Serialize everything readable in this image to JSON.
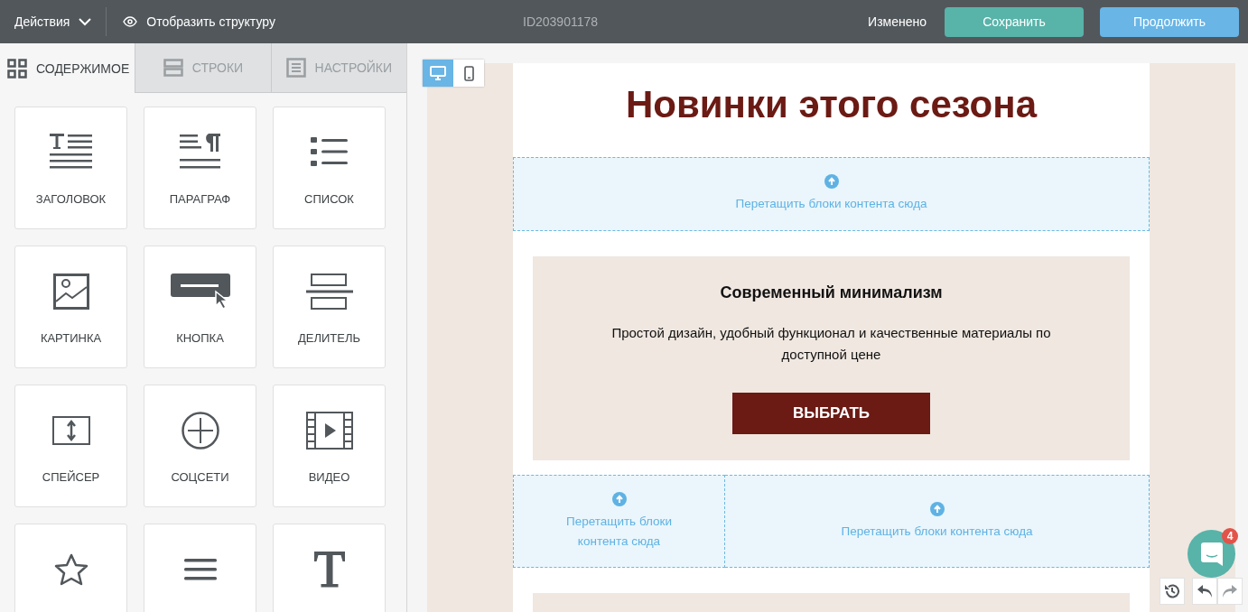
{
  "topbar": {
    "actions_menu": "Действия",
    "structure_toggle": "Отобразить структуру",
    "document_id": "ID203901178",
    "status": "Изменено",
    "buttons": [
      {
        "label": "Сохранить",
        "kind": "save"
      },
      {
        "label": "Продолжить",
        "kind": "continue"
      }
    ]
  },
  "sidebar": {
    "tabs": [
      {
        "label": "СОДЕРЖИМОЕ",
        "kind": "grid",
        "selected": true
      },
      {
        "label": "СТРОКИ",
        "kind": "rows",
        "selected": false
      },
      {
        "label": "НАСТРОЙКИ",
        "kind": "settings",
        "selected": false
      }
    ],
    "blocks": [
      {
        "label": "ЗАГОЛОВОК",
        "kind": "heading"
      },
      {
        "label": "ПАРАГРАФ",
        "kind": "paragraph"
      },
      {
        "label": "СПИСОК",
        "kind": "list"
      },
      {
        "label": "КАРТИНКА",
        "kind": "image"
      },
      {
        "label": "КНОПКА",
        "kind": "button"
      },
      {
        "label": "ДЕЛИТЕЛЬ",
        "kind": "divider"
      },
      {
        "label": "СПЕЙСЕР",
        "kind": "spacer"
      },
      {
        "label": "СОЦСЕТИ",
        "kind": "social"
      },
      {
        "label": "ВИДЕО",
        "kind": "video"
      },
      {
        "kind": "star"
      },
      {
        "kind": "menu"
      },
      {
        "kind": "text"
      }
    ]
  },
  "canvas": {
    "view_modes": [
      {
        "kind": "desktop",
        "selected": true
      },
      {
        "kind": "mobile",
        "selected": false
      }
    ],
    "title": "Новинки этого сезона",
    "drop_zone": "Перетащить блоки контента сюда",
    "card": {
      "heading": "Современный минимализм",
      "text": "Простой дизайн, удобный функционал и качественные материалы по доступной цене",
      "button": "ВЫБРАТЬ"
    },
    "drop_columns": [
      "Перетащить блоки контента сюда",
      "Перетащить блоки контента сюда"
    ]
  },
  "chat": {
    "badge": "4"
  }
}
